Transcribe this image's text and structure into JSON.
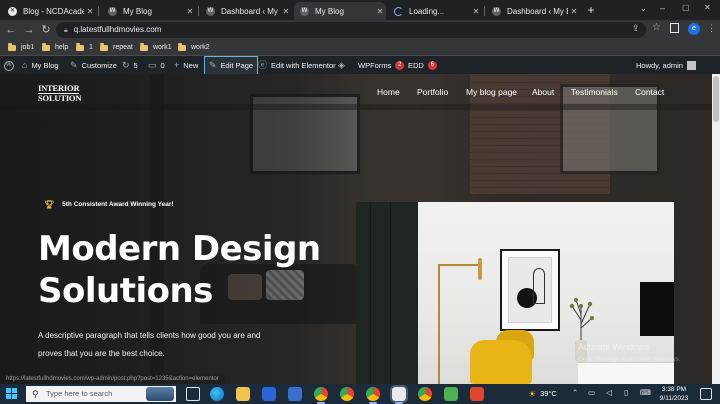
{
  "browser": {
    "tabs": [
      {
        "title": "Blog - NCDAcademy",
        "active": false
      },
      {
        "title": "My Blog",
        "active": false
      },
      {
        "title": "Dashboard ‹ My Blog",
        "active": false
      },
      {
        "title": "My Blog",
        "active": true
      },
      {
        "title": "Loading...",
        "active": false
      },
      {
        "title": "Dashboard ‹ My Blog",
        "active": false
      }
    ],
    "new_tab_icon": "plus-icon",
    "url": "q.latestfullhdmovies.com",
    "profile_initial": "e"
  },
  "bookmarks": [
    "job1",
    "help",
    "1",
    "repeat",
    "work1",
    "work2"
  ],
  "admin_bar": {
    "site_name": "My Blog",
    "customize": "Customize",
    "updates_count": "5",
    "comments_count": "0",
    "new_label": "New",
    "edit_page": "Edit Page",
    "elementor": "Edit with Elementor",
    "wpforms": "WPForms",
    "wpforms_count": "2",
    "edd": "EDD",
    "edd_count": "6",
    "howdy": "Howdy, admin"
  },
  "site": {
    "logo_line1": "INTERIOR",
    "logo_line2": "SOLUTION",
    "nav": [
      "Home",
      "Portfolio",
      "My blog page",
      "About",
      "Testimonials",
      "Contact"
    ],
    "award": "5th Consistent Award Winning Year!",
    "headline": "Modern Design Solutions",
    "description": "A descriptive paragraph that tells clients how good you are and proves that you are the best choice."
  },
  "watermark": {
    "line1": "Activate Windows",
    "line2": "Go to Settings to activate Windows."
  },
  "status_url": "https://latestfullhdmovies.com/wp-admin/post.php?post=1235&action=elementor",
  "taskbar": {
    "search_placeholder": "Type here to search",
    "temperature": "39°C",
    "time": "3:38 PM",
    "date": "9/11/2023"
  }
}
